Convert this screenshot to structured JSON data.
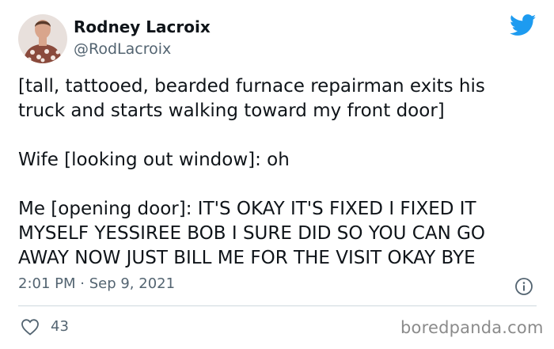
{
  "author": {
    "name": "Rodney Lacroix",
    "handle": "@RodLacroix"
  },
  "tweet": {
    "lines": [
      "[tall, tattooed, bearded furnace repairman exits his",
      "truck and starts walking toward my front door]",
      "",
      "Wife [looking out window]: oh",
      "",
      "Me [opening door]: IT'S OKAY IT'S FIXED I FIXED IT",
      "MYSELF YESSIREE BOB I SURE DID SO YOU CAN GO",
      "AWAY NOW JUST BILL ME FOR THE VISIT OKAY BYE"
    ],
    "timestamp": "2:01 PM · Sep 9, 2021"
  },
  "engagement": {
    "likes": "43"
  },
  "watermark": "boredpanda.com",
  "icons": {
    "brand": "twitter-bird-icon",
    "info": "info-icon",
    "like": "heart-icon"
  },
  "colors": {
    "twitter_blue": "#1d9bf0",
    "text_primary": "#0f1419",
    "text_secondary": "#536471",
    "divider": "#cfd9de"
  }
}
